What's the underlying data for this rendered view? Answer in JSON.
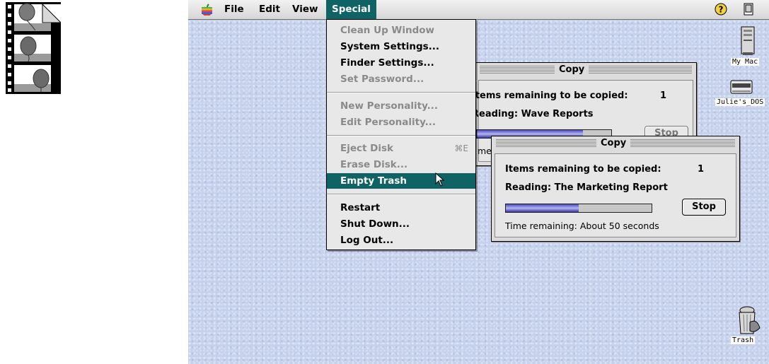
{
  "menubar": {
    "menus": [
      "File",
      "Edit",
      "View",
      "Special"
    ],
    "active_menu": "Special",
    "icons": [
      "apple-icon",
      "help-icon",
      "application-switcher-icon"
    ]
  },
  "special_menu": {
    "groups": [
      [
        {
          "label": "Clean Up Window",
          "enabled": false
        },
        {
          "label": "System Settings...",
          "enabled": true
        },
        {
          "label": "Finder Settings...",
          "enabled": true
        },
        {
          "label": "Set Password...",
          "enabled": false
        }
      ],
      [
        {
          "label": "New Personality...",
          "enabled": false
        },
        {
          "label": "Edit Personality...",
          "enabled": false
        }
      ],
      [
        {
          "label": "Eject Disk",
          "enabled": false,
          "shortcut": "⌘E"
        },
        {
          "label": "Erase Disk...",
          "enabled": false
        },
        {
          "label": "Empty Trash",
          "enabled": true,
          "highlighted": true
        }
      ],
      [
        {
          "label": "Restart",
          "enabled": true
        },
        {
          "label": "Shut Down...",
          "enabled": true
        },
        {
          "label": "Log Out...",
          "enabled": true
        }
      ]
    ]
  },
  "copy_back": {
    "title": "Copy",
    "items_label": "Items remaining to be copied:",
    "items_count": "1",
    "reading": "Reading: Wave Reports",
    "button": "Stop"
  },
  "copy_front": {
    "title": "Copy",
    "items_label": "Items remaining to be copied:",
    "items_count": "1",
    "reading": "Reading: The Marketing Report",
    "progress": 0.5,
    "button": "Stop",
    "time_remaining": "Time remaining:  About 50 seconds"
  },
  "desktop_icons": [
    {
      "label": "My Mac",
      "icon": "computer-icon"
    },
    {
      "label": "Julie's_DOS",
      "icon": "disk-drive-icon"
    },
    {
      "label": "Trash",
      "icon": "trash-icon"
    }
  ],
  "film_icon": "film-strip-icon",
  "colors": {
    "highlight": "#0f6364",
    "desktop": "#c5d1ec",
    "progress": "#4a4ac0"
  }
}
